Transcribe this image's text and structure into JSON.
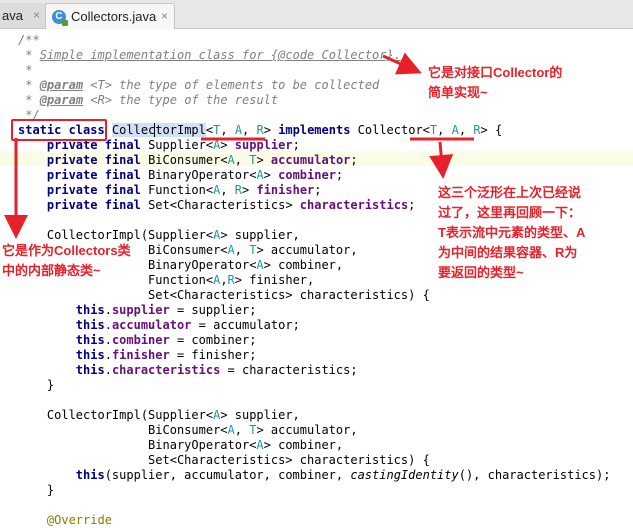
{
  "tabs": {
    "prev_label": "ava",
    "active_label": "Collectors.java",
    "close_glyph": "×"
  },
  "annotations": {
    "note1": "它是对接口Collector的简单实现~",
    "note2": "这三个泛形在上次已经说过了，这里再回顾一下：T表示流中元素的类型、A为中间的结果容器、R为要返回的类型~",
    "note3": "它是作为Collectors类中的内部静态类~"
  },
  "colors": {
    "annotation_red": "#e8202a",
    "keyword": "#000080",
    "field": "#660e7a",
    "type_param": "#20999d",
    "comment": "#808080"
  },
  "code": {
    "doc_open": "/**",
    "doc_star": "*",
    "doc_summary": "Simple implementation class for {@code Collector}.",
    "doc_param_tag": "@param",
    "doc_param1": " <T> the type of elements to be collected",
    "doc_param2": " <R> the type of the result",
    "doc_close": " */",
    "kw_private": "private",
    "kw_final": "final",
    "kw_this": "this",
    "field_supplier": "supplier",
    "field_accumulator": "accumulator",
    "field_combiner": "combiner",
    "field_finisher": "finisher",
    "field_characteristics": "characteristics",
    "annotation_override": "@Override"
  }
}
